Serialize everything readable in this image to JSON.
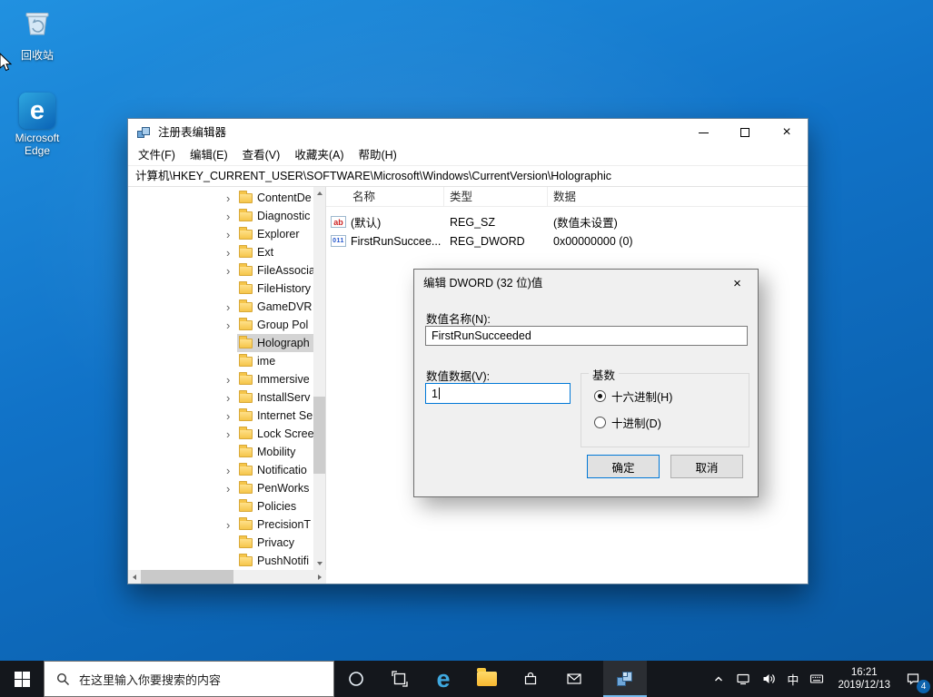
{
  "glyphs": {
    "tree_chevron": "›",
    "close": "×",
    "edge_letter": "e"
  },
  "desktop": {
    "icons": [
      {
        "name": "recycle-bin",
        "label": "回收站"
      },
      {
        "name": "edge",
        "label": "Microsoft Edge"
      }
    ]
  },
  "window": {
    "title": "注册表编辑器",
    "menu_items": [
      "文件(F)",
      "编辑(E)",
      "查看(V)",
      "收藏夹(A)",
      "帮助(H)"
    ],
    "address": "计算机\\HKEY_CURRENT_USER\\SOFTWARE\\Microsoft\\Windows\\CurrentVersion\\Holographic",
    "tree_items": [
      {
        "label": "ContentDe",
        "expand": true
      },
      {
        "label": "Diagnostic",
        "expand": true
      },
      {
        "label": "Explorer",
        "expand": true
      },
      {
        "label": "Ext",
        "expand": true
      },
      {
        "label": "FileAssocia",
        "expand": true
      },
      {
        "label": "FileHistory",
        "expand": false
      },
      {
        "label": "GameDVR",
        "expand": true
      },
      {
        "label": "Group Pol",
        "expand": true
      },
      {
        "label": "Holograph",
        "expand": false,
        "selected": true
      },
      {
        "label": "ime",
        "expand": false
      },
      {
        "label": "Immersive",
        "expand": true
      },
      {
        "label": "InstallServ",
        "expand": true
      },
      {
        "label": "Internet Se",
        "expand": true
      },
      {
        "label": "Lock Scree",
        "expand": true
      },
      {
        "label": "Mobility",
        "expand": false
      },
      {
        "label": "Notificatio",
        "expand": true
      },
      {
        "label": "PenWorks",
        "expand": true
      },
      {
        "label": "Policies",
        "expand": false
      },
      {
        "label": "PrecisionT",
        "expand": true
      },
      {
        "label": "Privacy",
        "expand": false
      },
      {
        "label": "PushNotifi",
        "expand": false
      }
    ],
    "columns": [
      "名称",
      "类型",
      "数据"
    ],
    "values": [
      {
        "sz": true,
        "icon_glyph": "ab",
        "name": "(默认)",
        "type": "REG_SZ",
        "data": "(数值未设置)"
      },
      {
        "dword": true,
        "icon_glyph": "011",
        "name": "FirstRunSuccee...",
        "type": "REG_DWORD",
        "data": "0x00000000 (0)"
      }
    ]
  },
  "dialog": {
    "title": "编辑 DWORD (32 位)值",
    "value_name_label": "数值名称(N):",
    "value_name": "FirstRunSucceeded",
    "value_data_label": "数值数据(V):",
    "value_data": "1",
    "base_label": "基数",
    "hex_label": "十六进制(H)",
    "dec_label": "十进制(D)",
    "ok_label": "确定",
    "cancel_label": "取消"
  },
  "taskbar": {
    "search_placeholder": "在这里输入你要搜索的内容",
    "ime_indicator": "中",
    "clock_time": "16:21",
    "clock_date": "2019/12/13",
    "notification_count": "4"
  },
  "colors": {
    "accent": "#0078d7",
    "taskbar": "#14171c",
    "desktop_top": "#2191e0",
    "desktop_bottom": "#0a58a0",
    "selection_inactive": "#d4d4d4"
  }
}
